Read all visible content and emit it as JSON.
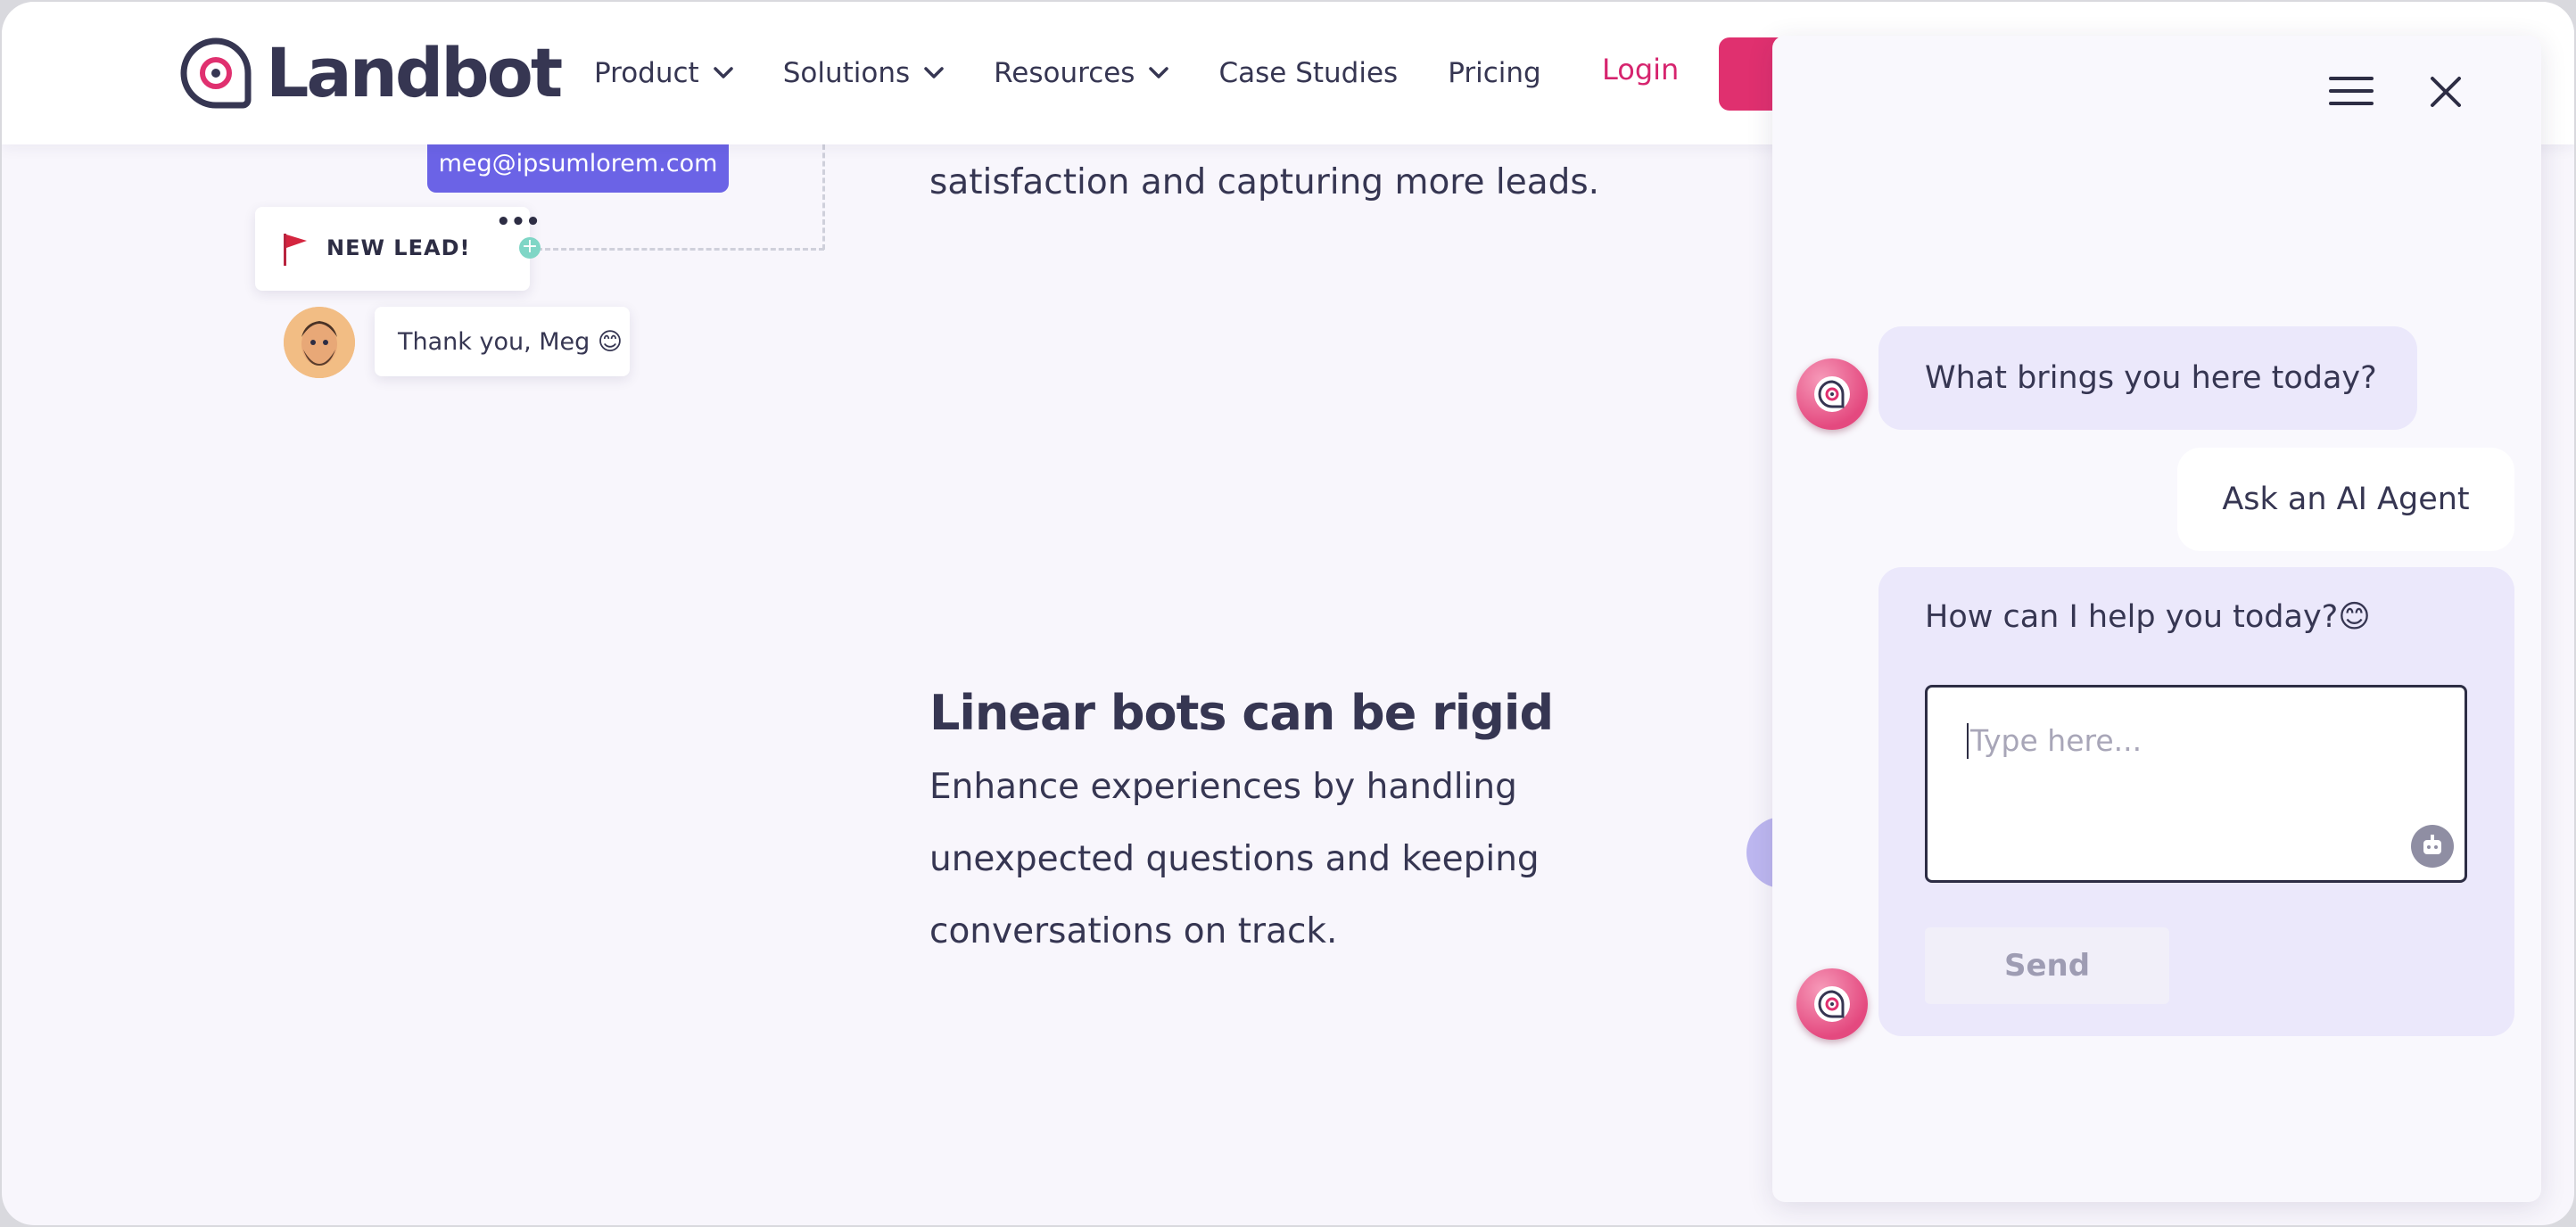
{
  "brand": {
    "name": "Landbot",
    "accent": "#d6246e",
    "primary_text": "#363652",
    "bubble_purple": "#6b63e6"
  },
  "nav": {
    "items": [
      {
        "label": "Product",
        "has_dropdown": true
      },
      {
        "label": "Solutions",
        "has_dropdown": true
      },
      {
        "label": "Resources",
        "has_dropdown": true
      },
      {
        "label": "Case Studies",
        "has_dropdown": false
      },
      {
        "label": "Pricing",
        "has_dropdown": false
      }
    ],
    "login": "Login"
  },
  "illustration": {
    "email": "meg@ipsumlorem.com",
    "lead_card": "NEW LEAD!",
    "lead_menu": "•••",
    "thanks": "Thank you,  Meg 😊"
  },
  "content": {
    "tagline": "satisfaction and capturing more leads.",
    "section_title": "Linear bots can be rigid",
    "section_body": "Enhance experiences by handling unexpected questions and keeping conversations on track."
  },
  "chat": {
    "messages": [
      {
        "from": "bot",
        "text": "What brings you here today?"
      },
      {
        "from": "user",
        "text": "Ask an AI Agent"
      },
      {
        "from": "bot",
        "text": "How can I help you today?😊"
      }
    ],
    "input_placeholder": "Type here...",
    "send_label": "Send",
    "icons": [
      "hamburger-menu-icon",
      "close-icon",
      "bot-avatar-icon",
      "robot-icon"
    ]
  }
}
